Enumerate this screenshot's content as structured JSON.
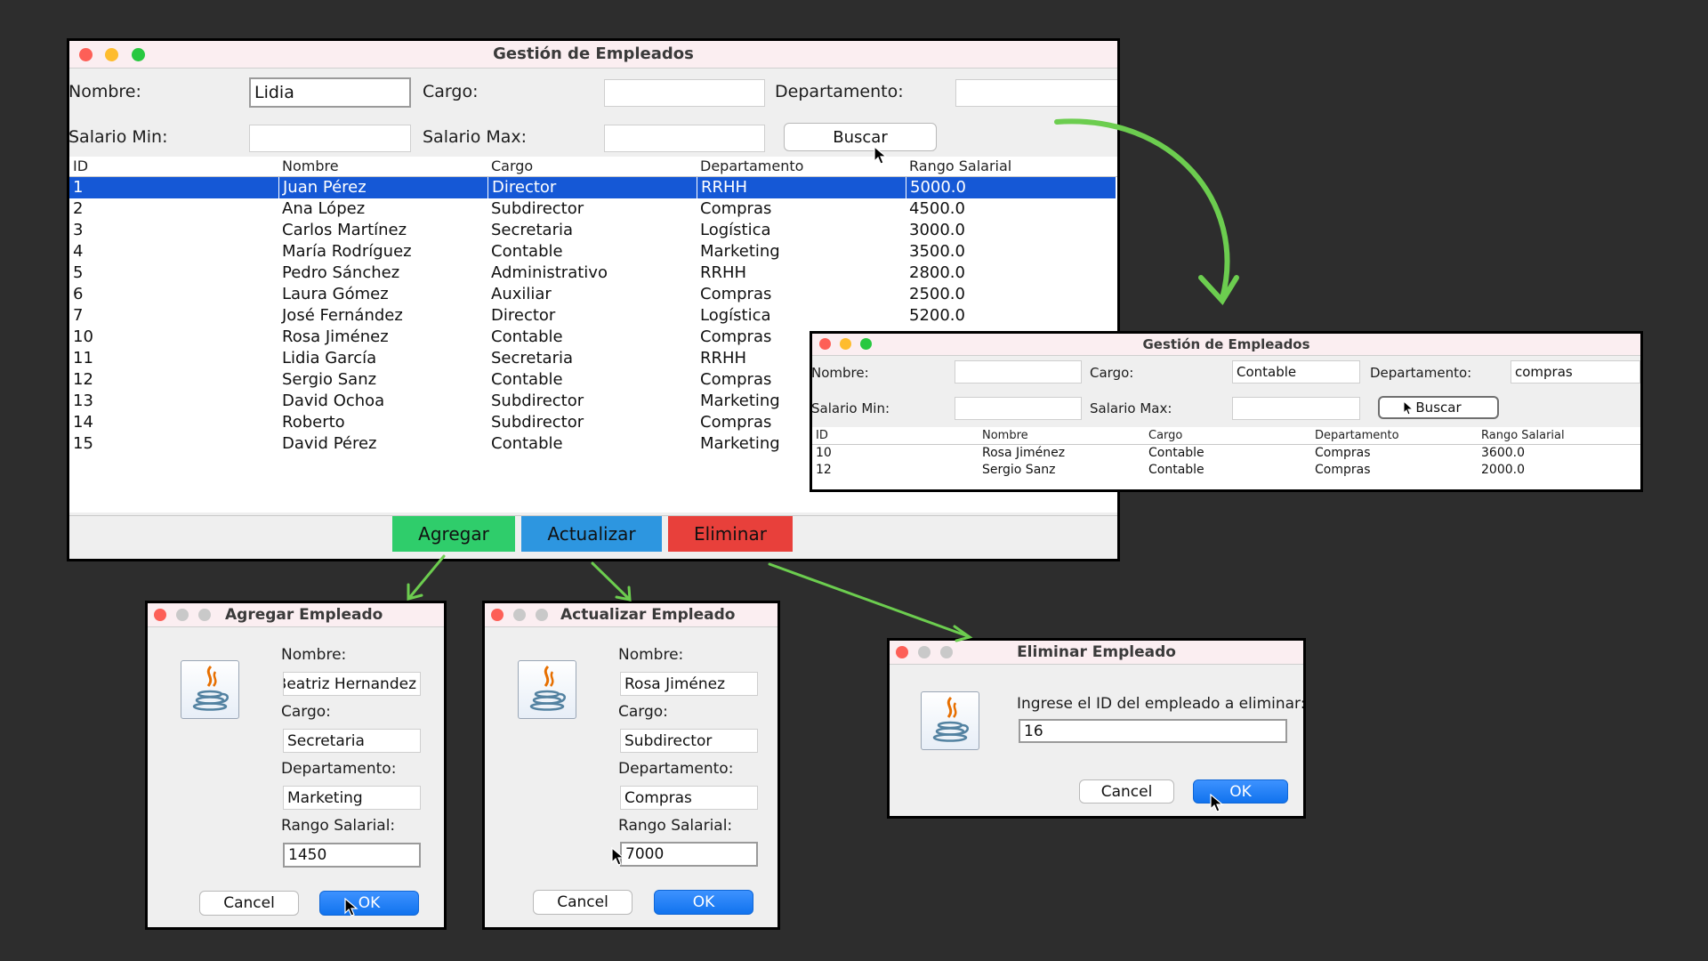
{
  "colors": {
    "agregar": "#2fcd6b",
    "actualizar": "#2d96e0",
    "eliminar": "#e8403b",
    "arrow": "#6ccd4f",
    "selected": "#1558d6"
  },
  "main": {
    "title": "Gestión de Empleados",
    "labels": {
      "nombre": "Nombre:",
      "cargo": "Cargo:",
      "departamento": "Departamento:",
      "salario_min": "Salario Min:",
      "salario_max": "Salario Max:"
    },
    "values": {
      "nombre": "Lidia",
      "cargo": "",
      "departamento": "",
      "salario_min": "",
      "salario_max": ""
    },
    "buscar": "Buscar",
    "columns": [
      "ID",
      "Nombre",
      "Cargo",
      "Departamento",
      "Rango Salarial"
    ],
    "rows": [
      [
        "1",
        "Juan Pérez",
        "Director",
        "RRHH",
        "5000.0"
      ],
      [
        "2",
        "Ana López",
        "Subdirector",
        "Compras",
        "4500.0"
      ],
      [
        "3",
        "Carlos Martínez",
        "Secretaria",
        "Logística",
        "3000.0"
      ],
      [
        "4",
        "María Rodríguez",
        "Contable",
        "Marketing",
        "3500.0"
      ],
      [
        "5",
        "Pedro Sánchez",
        "Administrativo",
        "RRHH",
        "2800.0"
      ],
      [
        "6",
        "Laura Gómez",
        "Auxiliar",
        "Compras",
        "2500.0"
      ],
      [
        "7",
        "José Fernández",
        "Director",
        "Logística",
        "5200.0"
      ],
      [
        "10",
        "Rosa Jiménez",
        "Contable",
        "Compras",
        ""
      ],
      [
        "11",
        "Lidia García",
        "Secretaria",
        "RRHH",
        ""
      ],
      [
        "12",
        "Sergio Sanz",
        "Contable",
        "Compras",
        ""
      ],
      [
        "13",
        "David Ochoa",
        "Subdirector",
        "Marketing",
        ""
      ],
      [
        "14",
        "Roberto",
        "Subdirector",
        "Compras",
        ""
      ],
      [
        "15",
        "David Pérez",
        "Contable",
        "Marketing",
        ""
      ]
    ],
    "actions": {
      "agregar": "Agregar",
      "actualizar": "Actualizar",
      "eliminar": "Eliminar"
    }
  },
  "search": {
    "title": "Gestión de Empleados",
    "labels": {
      "nombre": "Nombre:",
      "cargo": "Cargo:",
      "departamento": "Departamento:",
      "salario_min": "Salario Min:",
      "salario_max": "Salario Max:"
    },
    "values": {
      "nombre": "",
      "cargo": "Contable",
      "departamento": "compras",
      "salario_min": "",
      "salario_max": ""
    },
    "buscar": "Buscar",
    "columns": [
      "ID",
      "Nombre",
      "Cargo",
      "Departamento",
      "Rango Salarial"
    ],
    "rows": [
      [
        "10",
        "Rosa Jiménez",
        "Contable",
        "Compras",
        "3600.0"
      ],
      [
        "12",
        "Sergio Sanz",
        "Contable",
        "Compras",
        "2000.0"
      ]
    ]
  },
  "add_dialog": {
    "title": "Agregar Empleado",
    "labels": {
      "nombre": "Nombre:",
      "cargo": "Cargo:",
      "departamento": "Departamento:",
      "rango": "Rango Salarial:"
    },
    "values": {
      "nombre": "Beatriz Hernandez",
      "cargo": "Secretaria",
      "departamento": "Marketing",
      "rango": "1450"
    },
    "cancel": "Cancel",
    "ok": "OK"
  },
  "update_dialog": {
    "title": "Actualizar Empleado",
    "labels": {
      "nombre": "Nombre:",
      "cargo": "Cargo:",
      "departamento": "Departamento:",
      "rango": "Rango Salarial:"
    },
    "values": {
      "nombre": "Rosa Jiménez",
      "cargo": "Subdirector",
      "departamento": "Compras",
      "rango": "7000"
    },
    "cancel": "Cancel",
    "ok": "OK"
  },
  "delete_dialog": {
    "title": "Eliminar Empleado",
    "prompt": "Ingrese el ID del empleado a eliminar:",
    "value": "16",
    "cancel": "Cancel",
    "ok": "OK"
  }
}
